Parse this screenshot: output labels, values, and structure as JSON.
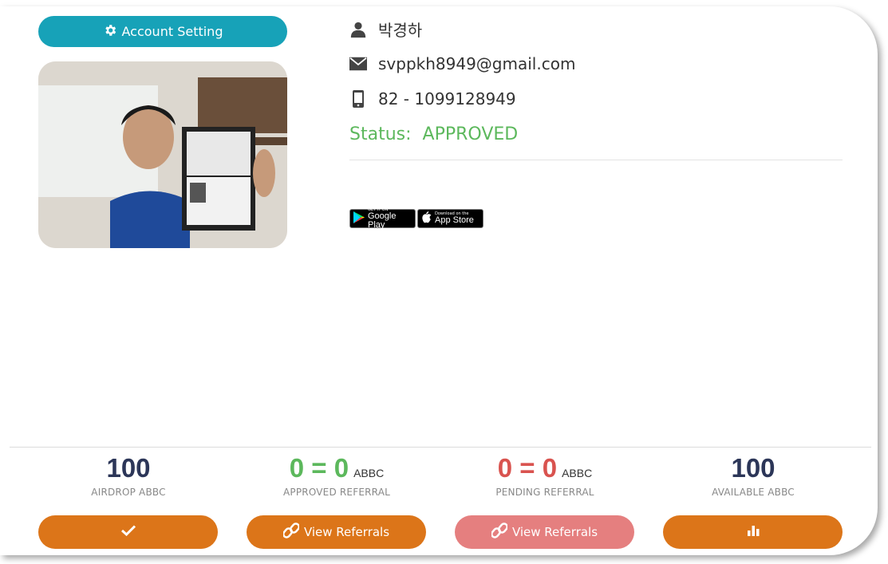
{
  "account_button": {
    "label": "Account Setting",
    "icon": "gear-icon"
  },
  "profile": {
    "name": "박경하",
    "email": "svppkh8949@gmail.com",
    "phone": "82 - 1099128949",
    "status_label": "Status:",
    "status_value": "APPROVED"
  },
  "stores": {
    "google": {
      "small": "GET IT ON",
      "big": "Google Play"
    },
    "apple": {
      "small": "Download on the",
      "big": "App Store"
    }
  },
  "stats": [
    {
      "value": "100",
      "unit": "",
      "label": "AIRDROP ABBC",
      "color": "#2c3658"
    },
    {
      "value": "0 = 0",
      "unit": "ABBC",
      "label": "APPROVED REFERRAL",
      "color": "#5cb85c"
    },
    {
      "value": "0 = 0",
      "unit": "ABBC",
      "label": "PENDING REFERRAL",
      "color": "#d9534f"
    },
    {
      "value": "100",
      "unit": "",
      "label": "AVAILABLE ABBC",
      "color": "#2c3658"
    }
  ],
  "actions": [
    {
      "label": "",
      "icon": "check-icon",
      "color": "#dc7519"
    },
    {
      "label": "View Referrals",
      "icon": "link-icon",
      "color": "#dc7519"
    },
    {
      "label": "View Referrals",
      "icon": "link-icon",
      "color": "#e57f7f"
    },
    {
      "label": "",
      "icon": "bar-chart-icon",
      "color": "#dc7519"
    }
  ],
  "colors": {
    "teal": "#17a2b8",
    "approved": "#5cb85c",
    "pending": "#d9534f",
    "orange": "#dc7519"
  }
}
